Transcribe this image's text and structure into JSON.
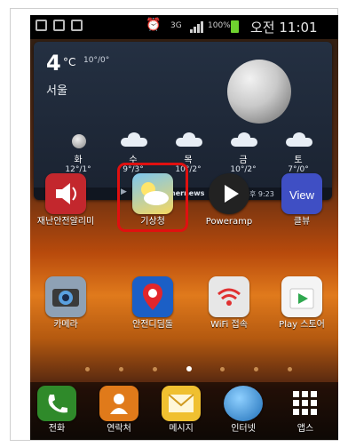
{
  "status_bar": {
    "carrier_icons": [
      "mail-icon",
      "gallery-icon",
      "check-icon"
    ],
    "alarm": "alarm-icon",
    "network": "3G",
    "battery": "100%",
    "time": "오전 11:01"
  },
  "weather": {
    "temp": "4",
    "unit": "°C",
    "range": "10°/0°",
    "city": "서울",
    "forecast": [
      {
        "day": "화",
        "temp": "12°/1°",
        "icon": "moon-icon"
      },
      {
        "day": "수",
        "temp": "9°/3°",
        "icon": "cloud-icon"
      },
      {
        "day": "목",
        "temp": "10°/2°",
        "icon": "cloud-icon"
      },
      {
        "day": "금",
        "temp": "10°/2°",
        "icon": "cloud-icon"
      },
      {
        "day": "토",
        "temp": "7°/0°",
        "icon": "cloud-icon"
      }
    ],
    "brand": "weathernews",
    "updated": "02/24 오후 9:23"
  },
  "apps_row1": [
    {
      "label": "재난안전알리미",
      "color": "#c3272d"
    },
    {
      "label": "기상청",
      "color": "#4aa6e0"
    },
    {
      "label": "Poweramp",
      "color": "#222222"
    },
    {
      "label": "클뷰",
      "color": "#3f4fc4"
    }
  ],
  "apps_row2": [
    {
      "label": "카메라",
      "color": "#7a8fa6"
    },
    {
      "label": "안전디딤돌",
      "color": "#1b5fc6"
    },
    {
      "label": "WiFi 접속",
      "color": "#e7e7e7"
    },
    {
      "label": "Play 스토어",
      "color": "#f4f4f4"
    }
  ],
  "dock": [
    {
      "label": "전화",
      "color": "#2f8a2a"
    },
    {
      "label": "연락처",
      "color": "#e07a1a"
    },
    {
      "label": "메시지",
      "color": "#f0c030"
    },
    {
      "label": "인터넷",
      "color": "#3a87c9"
    },
    {
      "label": "앱스",
      "color": "#ffffff"
    }
  ],
  "page_indicator": {
    "count": 7,
    "active": 4
  },
  "highlight_color": "#e01010"
}
